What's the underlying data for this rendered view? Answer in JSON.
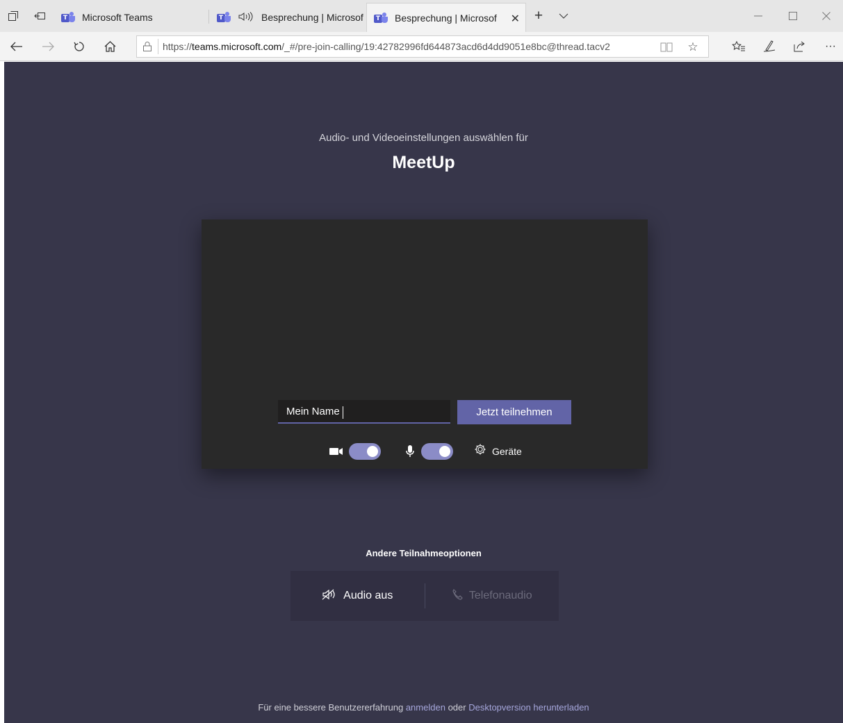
{
  "browser": {
    "tabs": [
      {
        "title": "Microsoft Teams",
        "audio": false,
        "active": false
      },
      {
        "title": "Besprechung | Microsof",
        "audio": true,
        "active": false
      },
      {
        "title": "Besprechung | Microsof",
        "audio": false,
        "active": true
      }
    ],
    "url_prefix": "https://",
    "url_domain": "teams.microsoft.com",
    "url_path": "/_#/pre-join-calling/19:42782996fd644873acd6d4dd9051e8bc@thread.tacv2"
  },
  "prejoin": {
    "subtitle": "Audio- und Videoeinstellungen auswählen für",
    "meeting_title": "MeetUp",
    "name_value": "Mein Name",
    "join_label": "Jetzt teilnehmen",
    "camera_on": true,
    "mic_on": true,
    "devices_label": "Geräte"
  },
  "other_options": {
    "title": "Andere Teilnahmeoptionen",
    "audio_off_label": "Audio aus",
    "phone_audio_label": "Telefonaudio"
  },
  "footer": {
    "prefix": "Für eine bessere Benutzererfahrung",
    "signin_link": "anmelden",
    "middle": "oder",
    "download_link": "Desktopversion herunterladen"
  },
  "colors": {
    "background": "#37364a",
    "accent": "#6264a7",
    "toggle": "#8b8cc7",
    "preview": "#292929"
  }
}
